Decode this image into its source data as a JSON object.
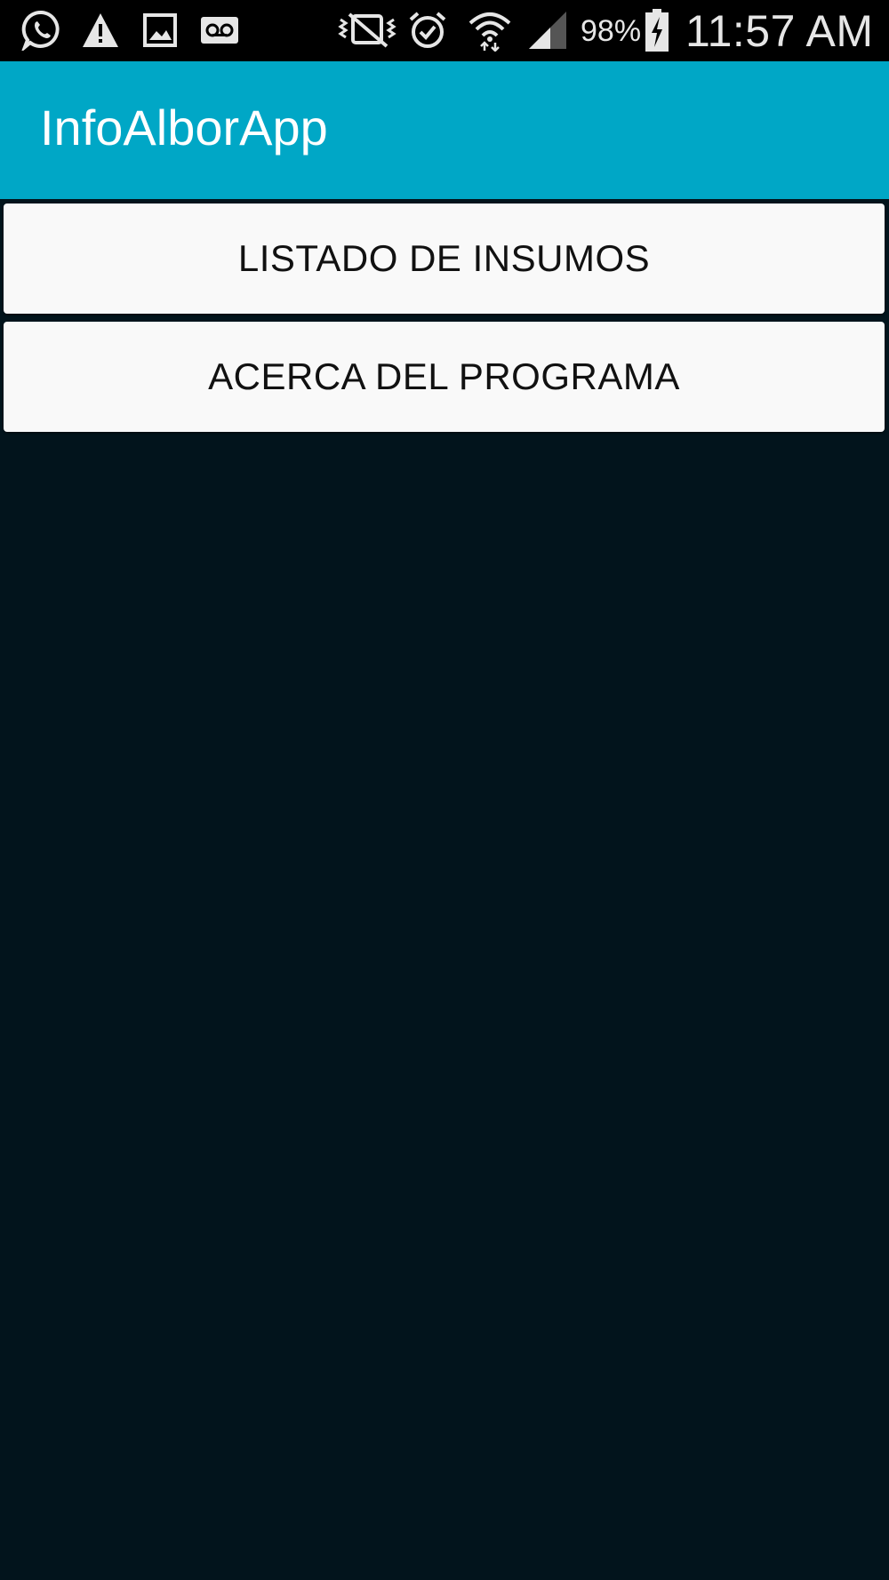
{
  "status_bar": {
    "icons_left": [
      "whatsapp-icon",
      "warning-icon",
      "image-icon",
      "voicemail-icon"
    ],
    "icons_right": [
      "vibrate-icon",
      "alarm-icon",
      "wifi-icon",
      "signal-icon",
      "battery-charging-icon"
    ],
    "battery_percent": "98%",
    "time": "11:57 AM"
  },
  "app_bar": {
    "title": "InfoAlborApp",
    "color": "#00a7c6"
  },
  "main": {
    "buttons": [
      {
        "label": "LISTADO DE INSUMOS"
      },
      {
        "label": "ACERCA DEL PROGRAMA"
      }
    ]
  },
  "colors": {
    "background": "#02141c",
    "button_background": "#f9f9f9",
    "status_bar": "#000000"
  }
}
